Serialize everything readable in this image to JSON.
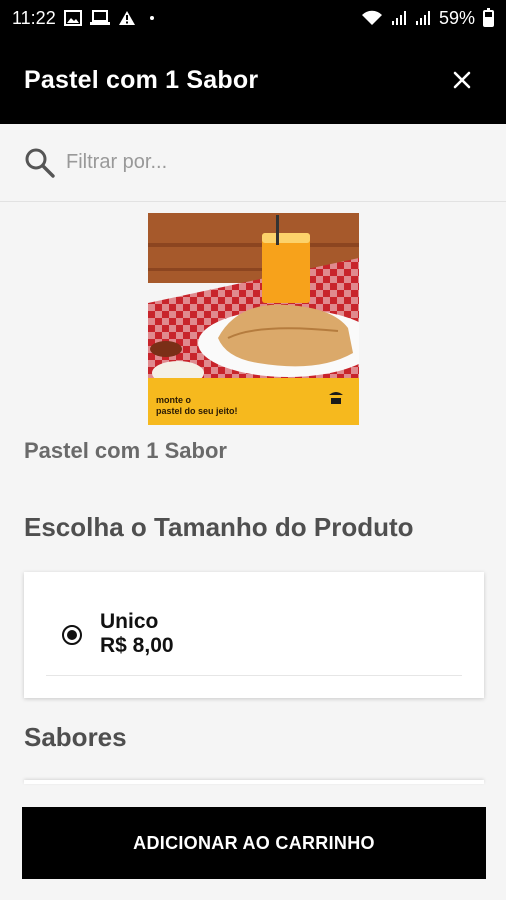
{
  "status_bar": {
    "time": "11:22",
    "battery": "59%",
    "icons": [
      "image-icon",
      "laptop-icon",
      "warning-icon",
      "wifi-icon",
      "signal-icon",
      "signal-icon",
      "battery-icon"
    ]
  },
  "header": {
    "title": "Pastel com 1 Sabor",
    "close_icon": "close-icon"
  },
  "search": {
    "placeholder": "Filtrar por...",
    "value": "",
    "icon": "search-icon"
  },
  "product": {
    "image_caption_line1": "monte o",
    "image_caption_line2": "pastel do seu jeito!",
    "name": "Pastel com 1 Sabor"
  },
  "size_section": {
    "title": "Escolha o Tamanho do Produto",
    "options": [
      {
        "name": "Unico",
        "price": "R$ 8,00",
        "selected": true
      }
    ]
  },
  "flavors_section": {
    "title": "Sabores"
  },
  "cart_button": {
    "label": "ADICIONAR AO CARRINHO"
  },
  "colors": {
    "header_bg": "#000000",
    "button_bg": "#000000",
    "accent_yellow": "#f6b91e"
  }
}
